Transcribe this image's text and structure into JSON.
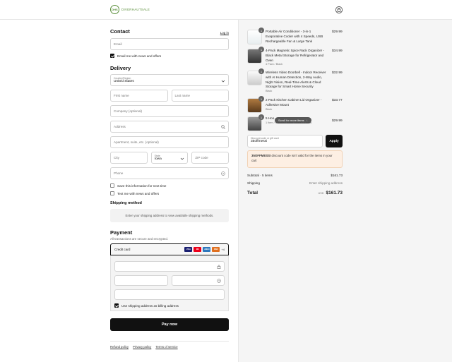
{
  "header": {
    "logo_initials": "DHS",
    "logo_text": "DIVERHAUTSALE",
    "bag_icon": "shopping-bag-icon"
  },
  "contact": {
    "title": "Contact",
    "login_label": "Log in",
    "email_placeholder": "Email",
    "news_label": "Email me with news and offers"
  },
  "delivery": {
    "title": "Delivery",
    "country_label": "Country/Region",
    "country_value": "United States",
    "first_name": "First name",
    "last_name": "Last name",
    "company": "Company (optional)",
    "address": "Address",
    "apartment": "Apartment, suite, etc. (optional)",
    "city": "City",
    "state_label": "State",
    "state_value": "Iowa",
    "zip": "ZIP code",
    "phone": "Phone",
    "save_info": "Save this information for next time",
    "text_news": "Text me with news and offers"
  },
  "shipping": {
    "title": "Shipping method",
    "message": "Enter your shipping address to view available shipping methods."
  },
  "payment": {
    "title": "Payment",
    "subtitle": "All transactions are secure and encrypted.",
    "method": "Credit card",
    "brands": [
      {
        "name": "VISA",
        "color": "#1a1f71"
      },
      {
        "name": "MC",
        "color": "#eb001b"
      },
      {
        "name": "AMEX",
        "color": "#2e77bc"
      },
      {
        "name": "DISC",
        "color": "#e07020"
      }
    ],
    "more": "+4",
    "billing_label": "Use shipping address as billing address",
    "pay_button": "Pay now"
  },
  "footer": {
    "links": [
      "Refund policy",
      "Privacy policy",
      "Terms of service"
    ]
  },
  "cart": {
    "items": [
      {
        "qty": "1",
        "title": "Portable Air Conditioner - 3-in-1 Evaporative Cooler with 4 Speeds, USB Rechargeable Fan & Large Tank",
        "variant": "",
        "price": "$29.99"
      },
      {
        "qty": "1",
        "title": "4-Pack Magnetic Spice Rack Organizer - Black Metal Storage for Refrigerator and Oven",
        "variant": "4 Pack / Black",
        "price": "$34.99"
      },
      {
        "qty": "1",
        "title": "Wireless Video Doorbell - Indoor Receiver with AI Human Detection, 2-Way Audio, Night Vision, Real-Time Alerts & Cloud Storage for Smart Home Security",
        "variant": "Black",
        "price": "$32.99"
      },
      {
        "qty": "1",
        "title": "2 Pack Kitchen Cabinet Lid Organizer - Adhesive Mount",
        "variant": "Black",
        "price": "$33.77"
      },
      {
        "qty": "1",
        "title": "5 Hoo",
        "variant": "1 Item / 5 hooks / black / none / 1 Pack",
        "price": "$29.99"
      }
    ],
    "scroll_hint": "Scroll for more items",
    "discount_label": "Discount code or gift card",
    "discount_value": "35offmessi",
    "apply": "Apply",
    "warning_code": "35OFFMESSI",
    "warning_text": " discount code isn't valid for the items in your cart",
    "subtotal_label": "Subtotal · 5 items",
    "subtotal_value": "$161.73",
    "shipping_label": "Shipping",
    "shipping_value": "Enter shipping address",
    "total_label": "Total",
    "currency": "USD",
    "total_value": "$161.73"
  }
}
